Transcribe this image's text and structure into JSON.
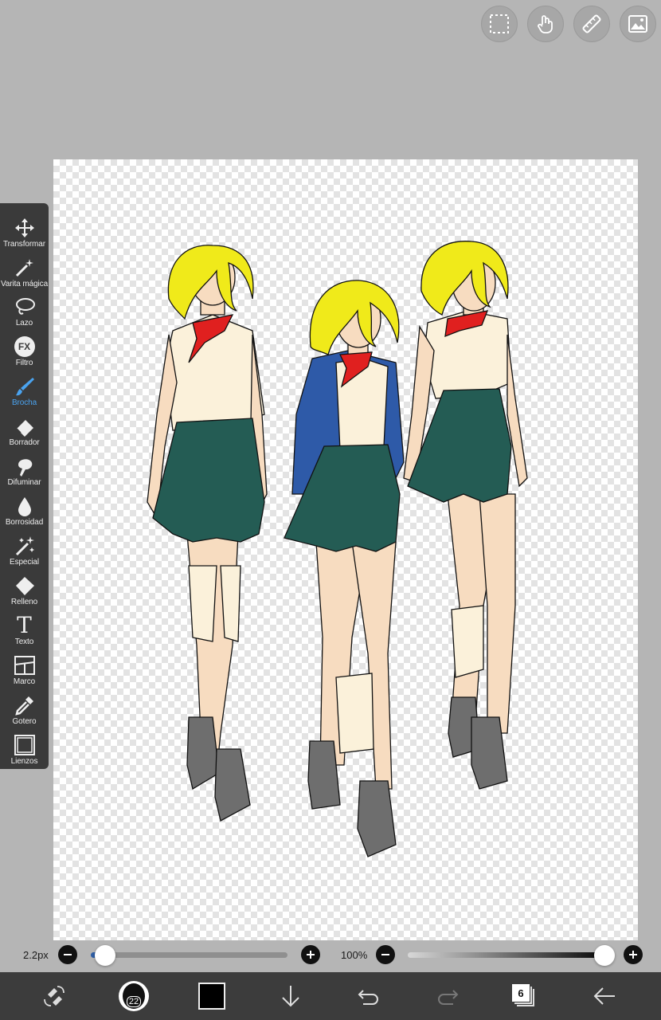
{
  "top_actions": {
    "selection_icon": "selection-icon",
    "hand_icon": "hand-icon",
    "ruler_icon": "ruler-icon",
    "image_icon": "image-icon"
  },
  "toolbar": {
    "items": [
      {
        "label": "Transformar",
        "icon": "transform-icon"
      },
      {
        "label": "Varita mágica",
        "icon": "magic-wand-icon"
      },
      {
        "label": "Lazo",
        "icon": "lasso-icon"
      },
      {
        "label": "Filtro",
        "icon": "fx-icon",
        "badge": "FX"
      },
      {
        "label": "Brocha",
        "icon": "brush-icon",
        "active": true
      },
      {
        "label": "Borrador",
        "icon": "eraser-icon"
      },
      {
        "label": "Difuminar",
        "icon": "smudge-icon"
      },
      {
        "label": "Borrosidad",
        "icon": "blur-icon"
      },
      {
        "label": "Especial",
        "icon": "special-icon"
      },
      {
        "label": "Relleno",
        "icon": "fill-icon"
      },
      {
        "label": "Texto",
        "icon": "text-icon",
        "glyph": "T"
      },
      {
        "label": "Marco",
        "icon": "frame-icon"
      },
      {
        "label": "Gotero",
        "icon": "eyedropper-icon"
      },
      {
        "label": "Lienzos",
        "icon": "canvases-icon"
      }
    ],
    "active_color": "#4aa3ef"
  },
  "brush_size": {
    "value_text": "2.2px",
    "level": 0.04
  },
  "opacity": {
    "value_text": "100%",
    "level": 1.0
  },
  "bottom_bar": {
    "brush_badge": "22",
    "color_swatch": "#000000",
    "layer_count": "6"
  }
}
